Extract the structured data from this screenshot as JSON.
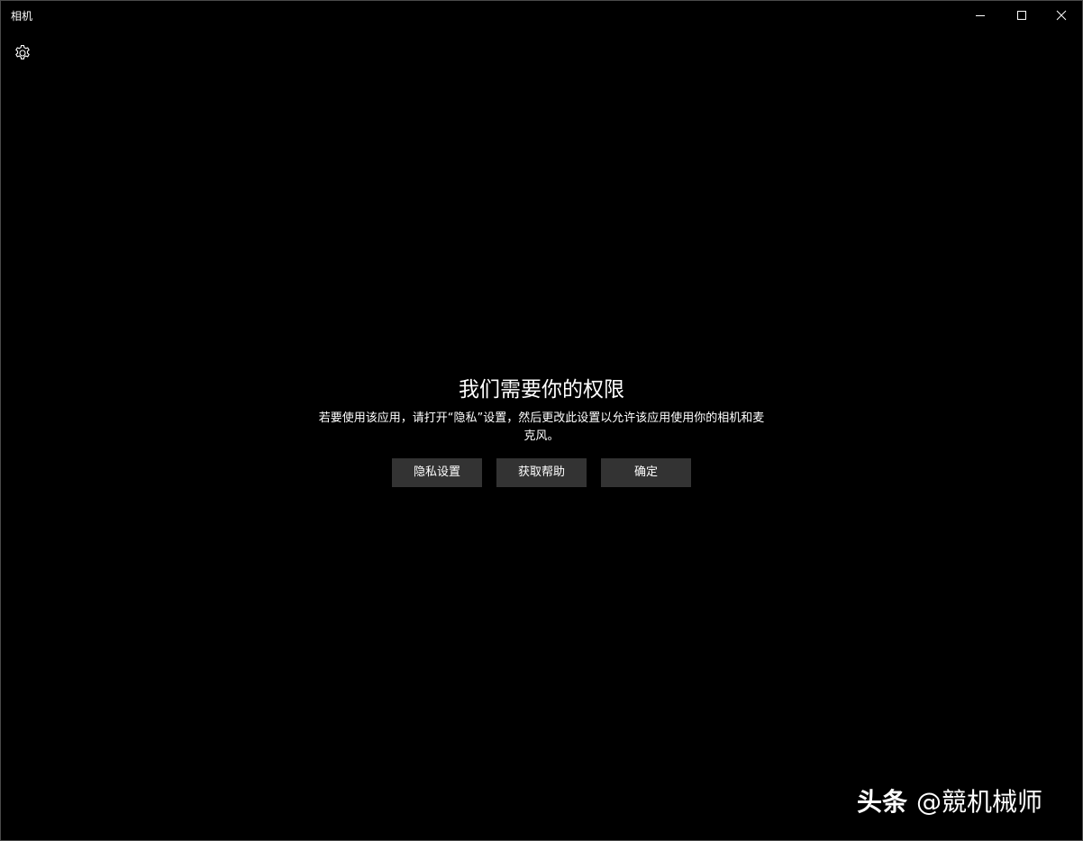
{
  "window": {
    "title": "相机",
    "controls": {
      "minimize_icon": "minimize-icon",
      "maximize_icon": "maximize-icon",
      "close_icon": "close-icon"
    }
  },
  "toolbar": {
    "settings_icon": "gear-icon"
  },
  "permission": {
    "heading": "我们需要你的权限",
    "message": "若要使用该应用，请打开“隐私”设置，然后更改此设置以允许该应用使用你的相机和麦克风。",
    "buttons": {
      "privacy_settings": "隐私设置",
      "get_help": "获取帮助",
      "ok": "确定"
    }
  },
  "watermark": {
    "brand": "头条",
    "handle": "@競机械师"
  },
  "colors": {
    "background": "#000000",
    "button_background": "#333333",
    "text": "#ffffff"
  }
}
